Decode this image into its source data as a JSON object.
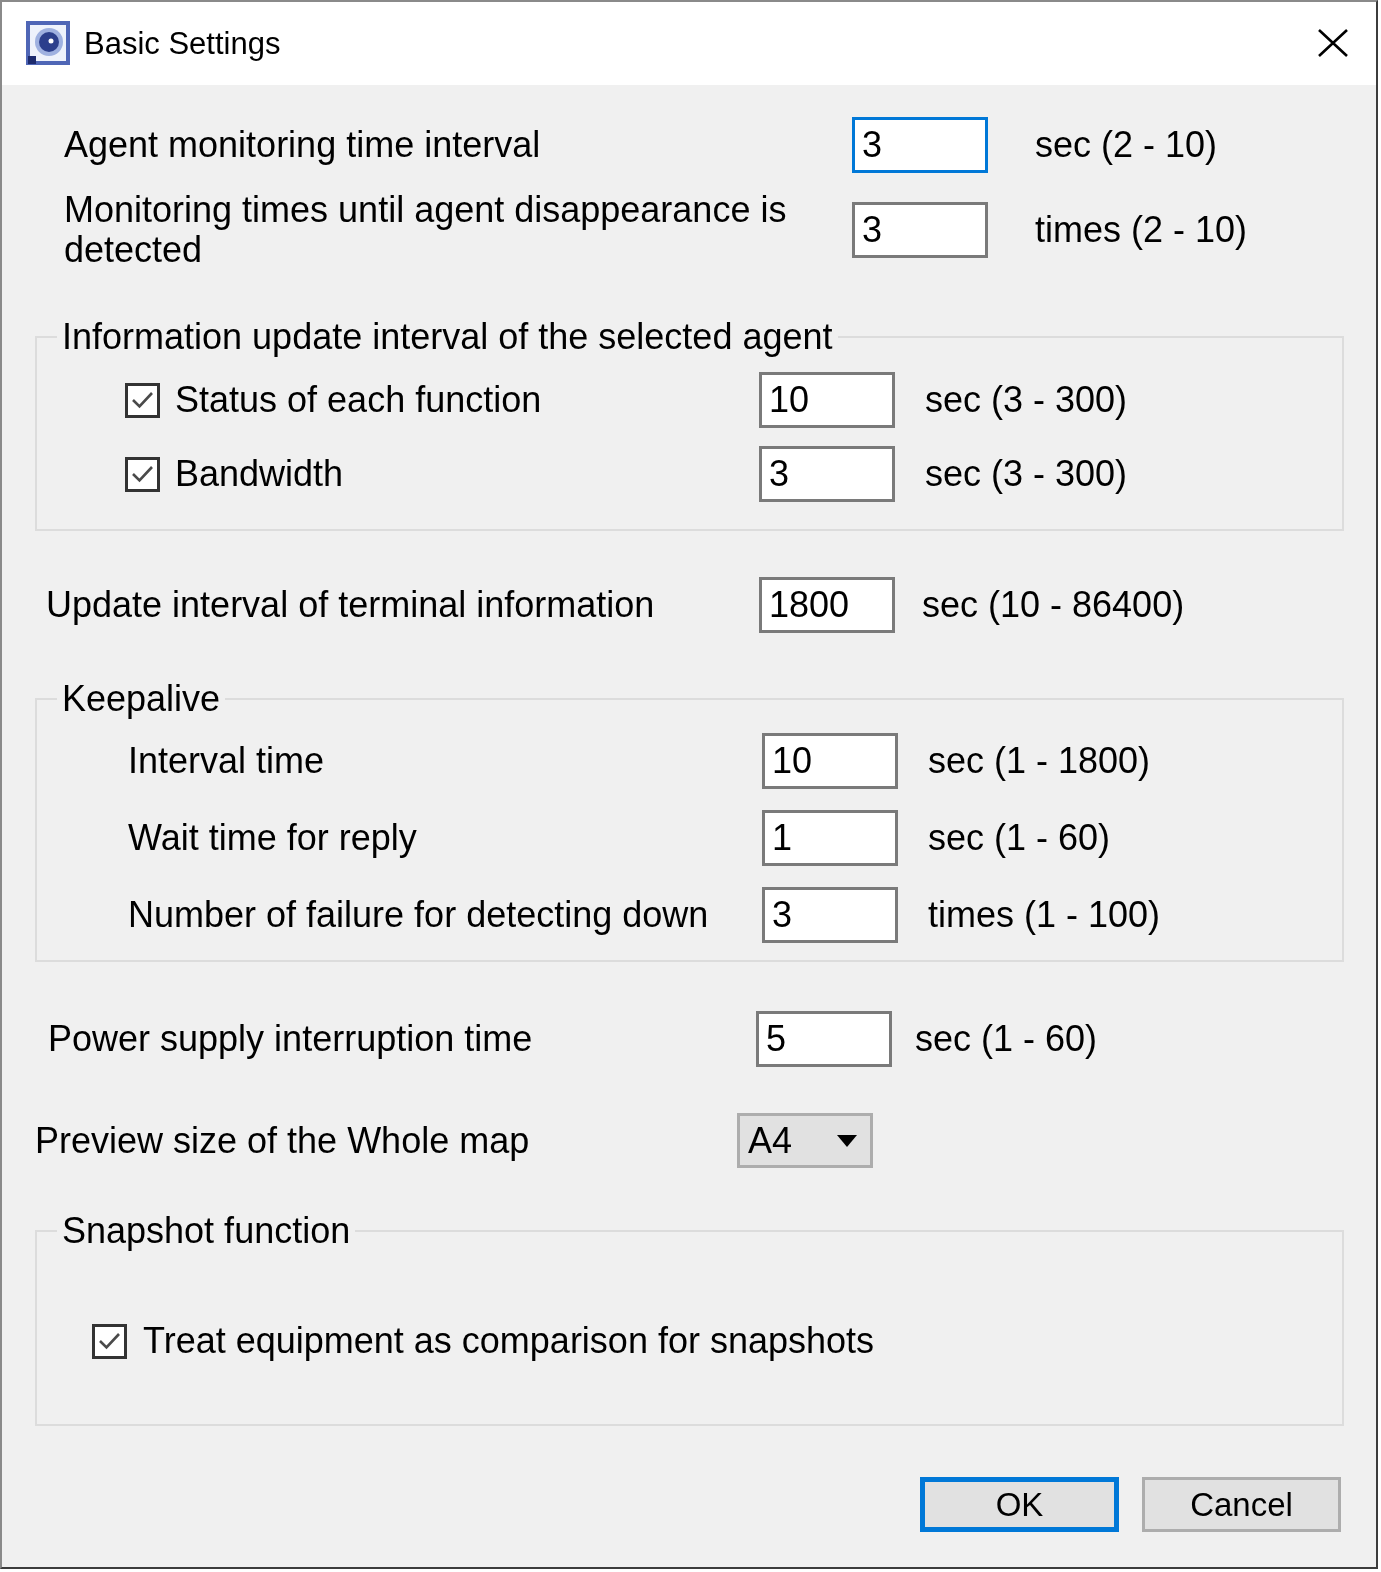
{
  "window": {
    "title": "Basic Settings"
  },
  "settings": [
    {
      "kind": "field",
      "label": "Agent monitoring time interval",
      "value": "3",
      "unit": "sec (2 - 10)",
      "focused": true
    },
    {
      "kind": "field",
      "label": "Monitoring times until agent disappearance is detected",
      "value": "3",
      "unit": "times (2 - 10)",
      "focused": false
    },
    {
      "kind": "group",
      "title": "Information update interval of the selected agent",
      "rows": [
        {
          "kind": "checkbox_field",
          "label": "Status of each function",
          "checked": true,
          "value": "10",
          "unit": "sec (3 - 300)",
          "focused": false
        },
        {
          "kind": "checkbox_field",
          "label": "Bandwidth",
          "checked": true,
          "value": "3",
          "unit": "sec (3 - 300)",
          "focused": false
        }
      ]
    },
    {
      "kind": "field",
      "label": "Update interval of terminal information",
      "value": "1800",
      "unit": "sec (10 - 86400)",
      "focused": false
    },
    {
      "kind": "group",
      "title": "Keepalive",
      "rows": [
        {
          "kind": "field",
          "label": "Interval time",
          "value": "10",
          "unit": "sec (1 - 1800)",
          "focused": false
        },
        {
          "kind": "field",
          "label": "Wait time for reply",
          "value": "1",
          "unit": "sec (1 - 60)",
          "focused": false
        },
        {
          "kind": "field",
          "label": "Number of failure for detecting down",
          "value": "3",
          "unit": "times (1 - 100)",
          "focused": false
        }
      ]
    },
    {
      "kind": "field",
      "label": "Power supply interruption time",
      "value": "5",
      "unit": "sec (1 - 60)",
      "focused": false
    },
    {
      "kind": "dropdown",
      "label": "Preview size of the Whole map",
      "value": "A4"
    },
    {
      "kind": "group",
      "title": "Snapshot function",
      "rows": [
        {
          "kind": "checkbox",
          "label": "Treat equipment as comparison for snapshots",
          "checked": true
        }
      ]
    }
  ],
  "buttons": [
    {
      "label": "OK",
      "default": true
    },
    {
      "label": "Cancel",
      "default": false
    }
  ]
}
